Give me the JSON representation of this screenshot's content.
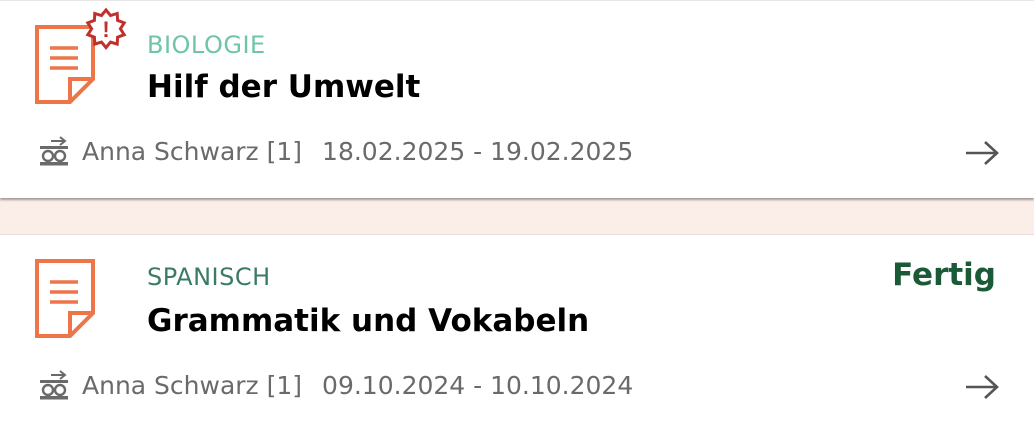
{
  "colors": {
    "accent_orange": "#ee7548",
    "alert_red": "#c0312e",
    "subject_teal": "#6fc4aa",
    "subject_green": "#3a7c63",
    "status_green": "#1a5a37",
    "meta_gray": "#6a6a6a",
    "separator_bg": "#fbede8"
  },
  "assignments": [
    {
      "subject": "BIOLOGIE",
      "title": "Hilf der Umwelt",
      "teacher": "Anna Schwarz [1]",
      "dates": "18.02.2025 - 19.02.2025",
      "status": "",
      "has_alert": true,
      "alert_symbol": "!",
      "icon": "document-icon",
      "teacher_icon": "teacher-icon",
      "action_icon": "arrow-right-icon"
    },
    {
      "subject": "SPANISCH",
      "title": "Grammatik und Vokabeln",
      "teacher": "Anna Schwarz [1]",
      "dates": "09.10.2024 - 10.10.2024",
      "status": "Fertig",
      "has_alert": false,
      "icon": "document-icon",
      "teacher_icon": "teacher-icon",
      "action_icon": "arrow-right-icon"
    }
  ]
}
